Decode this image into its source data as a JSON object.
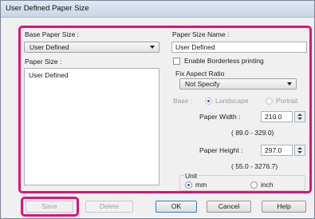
{
  "window": {
    "title": "User Defined Paper Size"
  },
  "base_paper_size": {
    "label": "Base Paper Size :",
    "value": "User Defined"
  },
  "paper_size_name": {
    "label": "Paper Size Name :",
    "value": "User Defined"
  },
  "paper_size": {
    "label": "Paper Size :",
    "items": [
      "User Defined"
    ]
  },
  "borderless": {
    "label": "Enable Borderless printing",
    "checked": false
  },
  "fix_aspect": {
    "label": "Fix Aspect Ratio",
    "value": "Not Specify"
  },
  "base": {
    "label": "Base :",
    "landscape": "Landscape",
    "portrait": "Portrait"
  },
  "paper_width": {
    "label": "Paper Width :",
    "value": "210.0",
    "range": "( 89.0 - 329.0)"
  },
  "paper_height": {
    "label": "Paper Height :",
    "value": "297.0",
    "range": "( 55.0 - 3276.7)"
  },
  "unit": {
    "label": "Unit",
    "mm": "mm",
    "inch": "inch",
    "selected": "mm"
  },
  "buttons": {
    "save": "Save",
    "delete": "Delete",
    "ok": "OK",
    "cancel": "Cancel",
    "help": "Help"
  },
  "colors": {
    "highlight": "#e0127a",
    "accent": "#2a62c9"
  }
}
